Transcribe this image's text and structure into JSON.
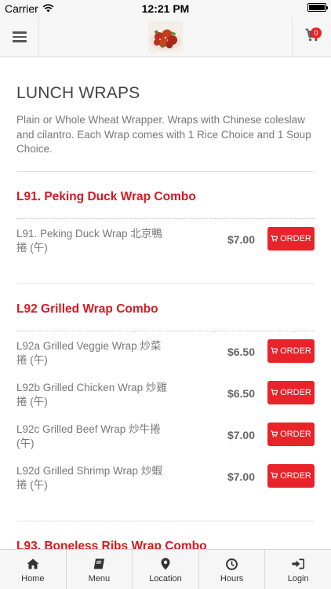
{
  "status_bar": {
    "carrier": "Carrier",
    "time": "12:21 PM"
  },
  "header": {
    "cart_count": "0"
  },
  "section": {
    "title": "LUNCH WRAPS",
    "description": "Plain or Whole Wheat Wrapper. Wraps with Chinese coleslaw and cilantro. Each Wrap comes with 1 Rice Choice and 1 Soup Choice."
  },
  "order_label": "ORDER",
  "groups": [
    {
      "title": "L91. Peking Duck Wrap Combo",
      "items": [
        {
          "name": "L91. Peking Duck Wrap 北京鴨捲 (午)",
          "price": "$7.00"
        }
      ]
    },
    {
      "title": "L92 Grilled Wrap Combo",
      "items": [
        {
          "name": "L92a Grilled Veggie Wrap 炒菜捲 (午)",
          "price": "$6.50"
        },
        {
          "name": "L92b Grilled Chicken Wrap 炒雞捲 (午)",
          "price": "$6.50"
        },
        {
          "name": "L92c Grilled Beef Wrap 炒牛捲 (午)",
          "price": "$7.00"
        },
        {
          "name": "L92d Grilled Shrimp Wrap 炒蝦捲 (午)",
          "price": "$7.00"
        }
      ]
    },
    {
      "title": "L93. Boneless Ribs Wrap Combo",
      "items": []
    }
  ],
  "tabs": [
    {
      "label": "Home",
      "icon": "home-icon"
    },
    {
      "label": "Menu",
      "icon": "book-icon"
    },
    {
      "label": "Location",
      "icon": "map-pin-icon"
    },
    {
      "label": "Hours",
      "icon": "clock-icon"
    },
    {
      "label": "Login",
      "icon": "sign-in-icon"
    }
  ],
  "colors": {
    "accent": "#e8232a",
    "group_title": "#d71920"
  }
}
